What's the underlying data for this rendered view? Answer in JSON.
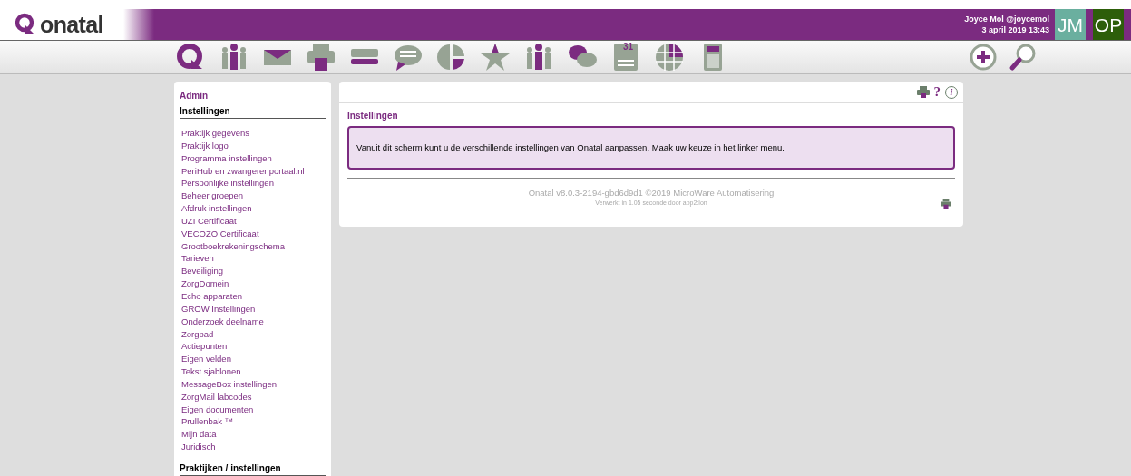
{
  "header": {
    "logo": "onatal",
    "user": "Joyce Mol @joycemol",
    "datetime": "3 april 2019 13:43",
    "avatars": [
      {
        "initials": "JM",
        "color": "#6aaf9f"
      },
      {
        "initials": "OP",
        "color": "#2d5e0a"
      }
    ]
  },
  "toolbar": {
    "items": [
      {
        "kind": "logo"
      },
      {
        "kind": "people"
      },
      {
        "kind": "mail"
      },
      {
        "kind": "printer"
      },
      {
        "kind": "card"
      },
      {
        "kind": "speech"
      },
      {
        "kind": "chart"
      },
      {
        "kind": "star"
      },
      {
        "kind": "people"
      },
      {
        "kind": "chat"
      },
      {
        "kind": "calendar",
        "label": "31"
      },
      {
        "kind": "globe"
      },
      {
        "kind": "calculator"
      }
    ],
    "right_items": [
      {
        "kind": "plus"
      },
      {
        "kind": "search"
      }
    ]
  },
  "sidebar": {
    "title": "Admin",
    "sections": [
      {
        "heading": "Instellingen",
        "items": [
          "Praktijk gegevens",
          "Praktijk logo",
          "Programma instellingen",
          "PeriHub en zwangerenportaal.nl",
          "Persoonlijke instellingen",
          "Beheer groepen",
          "Afdruk instellingen",
          "UZI Certificaat",
          "VECOZO Certificaat",
          "Grootboekrekeningschema",
          "Tarieven",
          "Beveiliging",
          "ZorgDomein",
          "Echo apparaten",
          "GROW Instellingen",
          "Onderzoek deelname",
          "Zorgpad",
          "Actiepunten",
          "Eigen velden",
          "Tekst sjablonen",
          "MessageBox instellingen",
          "ZorgMail labcodes",
          "Eigen documenten",
          "Prullenbak ™",
          "Mijn data",
          "Juridisch"
        ]
      },
      {
        "heading": "Praktijken / instellingen"
      }
    ]
  },
  "main": {
    "tools": [
      {
        "kind": "printer"
      },
      {
        "kind": "help",
        "label": "?"
      },
      {
        "kind": "info",
        "label": "i"
      }
    ],
    "title": "Instellingen",
    "message": "Vanuit dit scherm kunt u de verschillende instellingen van Onatal aanpassen. Maak uw keuze in het linker menu.",
    "footer": "Onatal v8.0.3-2194-gbd6d9d1 ©2019 MicroWare Automatisering",
    "footer_note": "Verwerkt in 1.05 seconde door app2:lon"
  }
}
